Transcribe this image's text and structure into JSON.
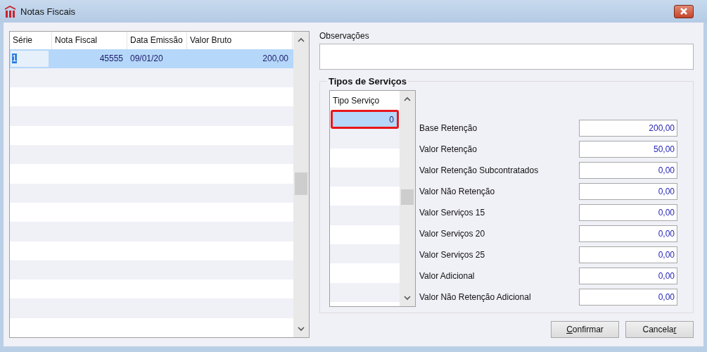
{
  "window": {
    "title": "Notas Fiscais"
  },
  "invoices": {
    "columns": [
      {
        "label": "Série"
      },
      {
        "label": "Nota Fiscal"
      },
      {
        "label": "Data Emissão"
      },
      {
        "label": "Valor Bruto"
      }
    ],
    "rows": [
      {
        "cells": [
          "1",
          "45555",
          "09/01/20",
          "200,00"
        ],
        "selected": true,
        "editing": true
      }
    ]
  },
  "observations": {
    "label": "Observações"
  },
  "service_types": {
    "title": "Tipos de Serviços",
    "column": "Tipo Serviço",
    "rows": [
      {
        "value": "0",
        "selected": true
      }
    ]
  },
  "fields": [
    {
      "label": "Base Retenção",
      "value": "200,00"
    },
    {
      "label": "Valor Retenção",
      "value": "50,00"
    },
    {
      "label": "Valor Retenção Subcontratados",
      "value": "0,00"
    },
    {
      "label": "Valor Não Retenção",
      "value": "0,00"
    },
    {
      "label": "Valor Serviços 15",
      "value": "0,00"
    },
    {
      "label": "Valor Serviços 20",
      "value": "0,00"
    },
    {
      "label": "Valor Serviços 25",
      "value": "0,00"
    },
    {
      "label": "Valor Adicional",
      "value": "0,00"
    },
    {
      "label": "Valor Não Retenção Adicional",
      "value": "0,00"
    }
  ],
  "buttons": [
    {
      "label": "Confirmar"
    },
    {
      "label": "Cancelar"
    }
  ]
}
